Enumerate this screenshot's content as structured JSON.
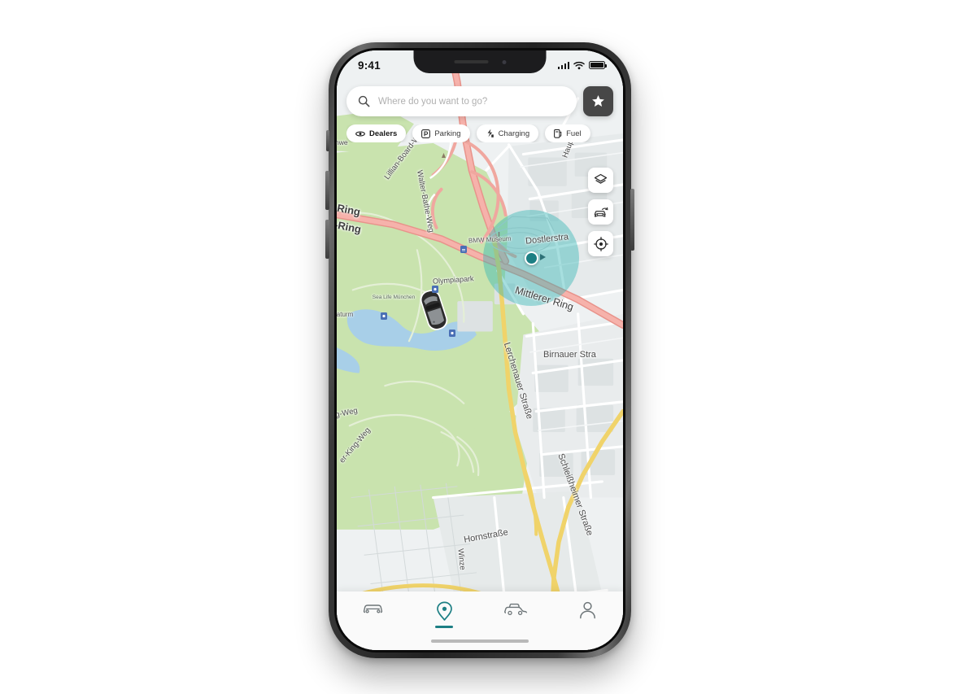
{
  "device": {
    "status_bar": {
      "time": "9:41",
      "signal_icon": "signal-bars-icon",
      "wifi_icon": "wifi-icon",
      "battery_icon": "battery-icon"
    },
    "notch": {
      "speaker": "notch-speaker",
      "camera": "notch-camera"
    },
    "buttons": {
      "silent": "silent-switch",
      "volume_up": "volume-up-button",
      "volume_down": "volume-down-button",
      "power": "power-button"
    },
    "home_indicator": "home-indicator"
  },
  "search": {
    "icon": "search-icon",
    "placeholder": "Where do you want to go?",
    "value": "",
    "favorites_icon": "star-icon"
  },
  "filters": [
    {
      "label": "Dealers",
      "icon": "dealer-icon",
      "active": true
    },
    {
      "label": "Parking",
      "icon": "parking-icon",
      "active": false
    },
    {
      "label": "Charging",
      "icon": "charging-icon",
      "active": false
    },
    {
      "label": "Fuel",
      "icon": "fuel-icon",
      "active": false
    }
  ],
  "map_controls": [
    {
      "name": "layers-button",
      "icon": "layers-icon"
    },
    {
      "name": "vehicle-view-button",
      "icon": "car-360-icon"
    },
    {
      "name": "recenter-button",
      "icon": "crosshair-icon"
    }
  ],
  "bottom_nav": [
    {
      "label": "vehicle",
      "icon": "car-front-icon",
      "active": false
    },
    {
      "label": "location",
      "icon": "location-pin-icon",
      "active": true
    },
    {
      "label": "services",
      "icon": "car-side-icon",
      "active": false
    },
    {
      "label": "profile",
      "icon": "person-icon",
      "active": false
    }
  ],
  "map": {
    "user_location": {
      "label": "user-location-puck",
      "heading": "east"
    },
    "vehicle_marker": {
      "label": "parked-vehicle-marker"
    },
    "street_labels": [
      "-Ring",
      "r-Ring",
      "Lillian-Board-Weg",
      "Walter-Bathe-Weg",
      "Hauptma",
      "Dostlerstra",
      "Mittlerer Ring",
      "Birnauer Stra",
      "Lerchenauer Straße",
      "Schleißheimer Straße",
      "Hornstraße",
      "g-Weg",
      "er-King-Weg",
      "Winze",
      "Olympiapark",
      "nwe"
    ],
    "poi_labels": [
      "BMW Museum",
      "Sea Life München",
      "iaturm"
    ],
    "colors": {
      "park": "#c9e3ae",
      "water": "#a8cfe8",
      "land": "#eef1f2",
      "building": "#e3e7e8",
      "motorway": "#f2a199",
      "primary": "#f5dd7a",
      "street": "#ffffff",
      "user_accent": "#1d7f84",
      "user_halo": "rgba(45,178,178,.42)",
      "accent": "#1d7f84",
      "favorites_bg": "#474747"
    }
  }
}
